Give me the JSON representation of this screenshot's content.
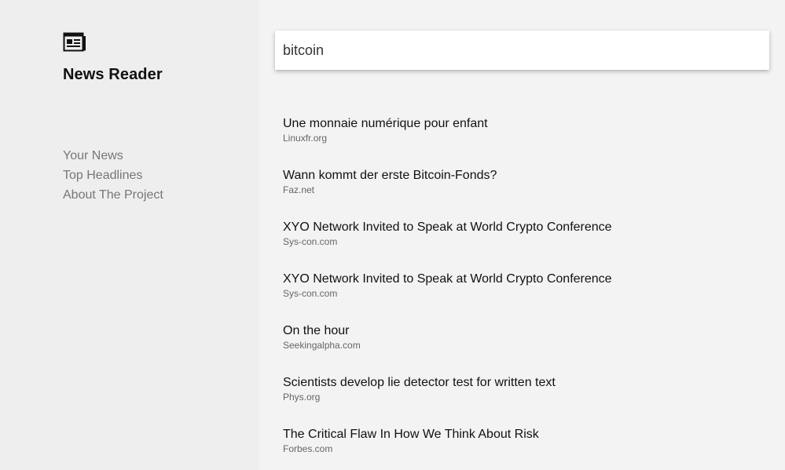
{
  "sidebar": {
    "logo_icon": "newspaper-icon",
    "title": "News Reader",
    "nav": [
      {
        "label": "Your News"
      },
      {
        "label": "Top Headlines"
      },
      {
        "label": "About The Project"
      }
    ]
  },
  "search": {
    "value": "bitcoin"
  },
  "articles": [
    {
      "title": "Une monnaie numérique pour enfant",
      "source": "Linuxfr.org"
    },
    {
      "title": "Wann kommt der erste Bitcoin-Fonds?",
      "source": "Faz.net"
    },
    {
      "title": "XYO Network Invited to Speak at World Crypto Conference",
      "source": "Sys-con.com"
    },
    {
      "title": "XYO Network Invited to Speak at World Crypto Conference",
      "source": "Sys-con.com"
    },
    {
      "title": "On the hour",
      "source": "Seekingalpha.com"
    },
    {
      "title": "Scientists develop lie detector test for written text",
      "source": "Phys.org"
    },
    {
      "title": "The Critical Flaw In How We Think About Risk",
      "source": "Forbes.com"
    }
  ],
  "colors": {
    "sidebar_bg": "#eeeeee",
    "main_bg": "#f3f3f3",
    "nav_text": "#777777",
    "source_text": "#666666"
  }
}
